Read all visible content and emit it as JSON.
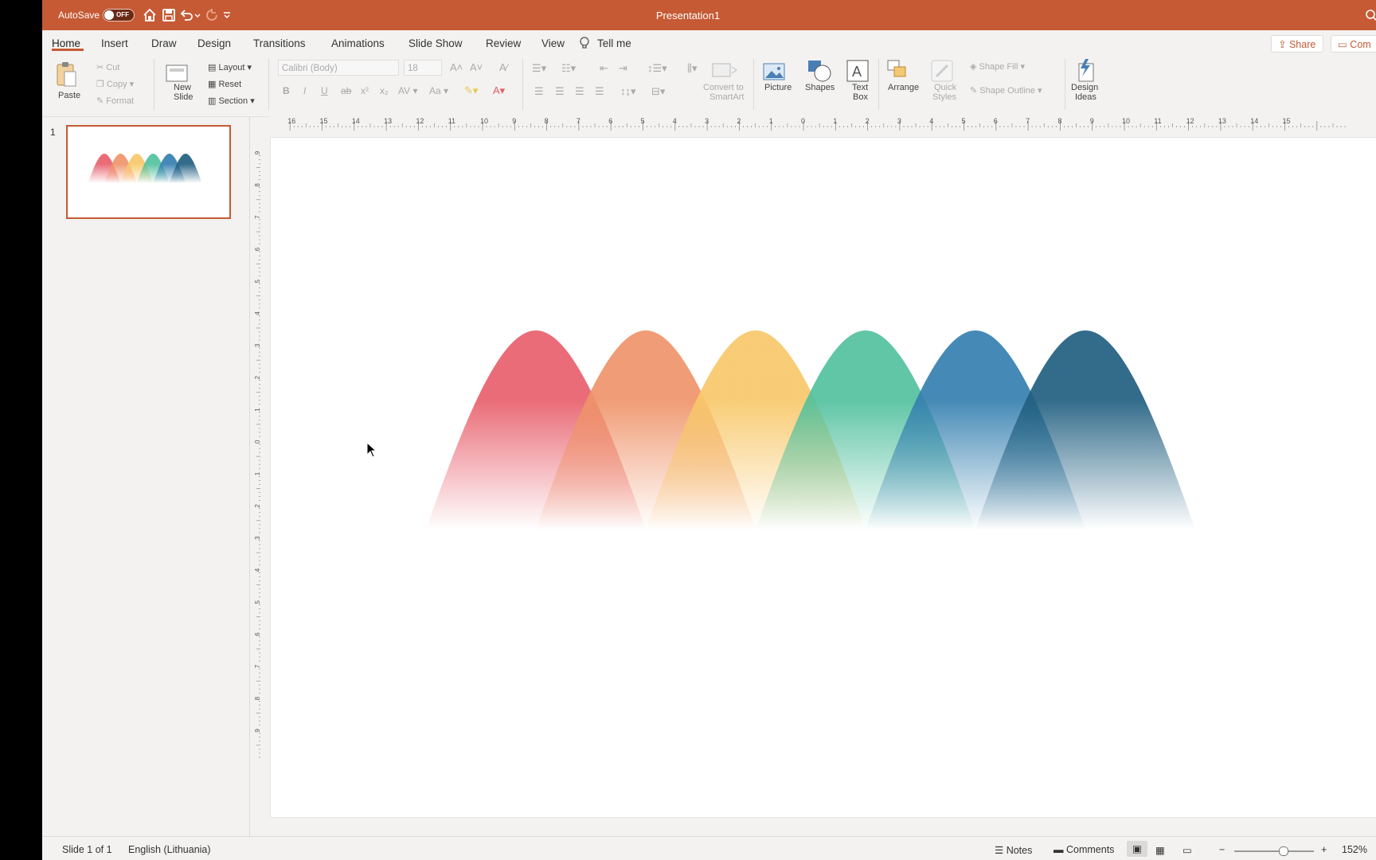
{
  "titlebar": {
    "autosave_label": "AutoSave",
    "autosave_state": "OFF",
    "doc_title": "Presentation1"
  },
  "tabs": [
    {
      "label": "Home"
    },
    {
      "label": "Insert"
    },
    {
      "label": "Draw"
    },
    {
      "label": "Design"
    },
    {
      "label": "Transitions"
    },
    {
      "label": "Animations"
    },
    {
      "label": "Slide Show"
    },
    {
      "label": "Review"
    },
    {
      "label": "View"
    }
  ],
  "tell_me": "Tell me",
  "share_label": "Share",
  "comments_btn_label": "Com",
  "ribbon": {
    "paste": "Paste",
    "cut": "Cut",
    "copy": "Copy",
    "format": "Format",
    "new_slide_1": "New",
    "new_slide_2": "Slide",
    "layout": "Layout",
    "reset": "Reset",
    "section": "Section",
    "font_name": "Calibri (Body)",
    "font_size": "18",
    "convert_1": "Convert to",
    "convert_2": "SmartArt",
    "picture": "Picture",
    "shapes": "Shapes",
    "textbox_1": "Text",
    "textbox_2": "Box",
    "arrange": "Arrange",
    "quick_1": "Quick",
    "quick_2": "Styles",
    "shape_fill": "Shape Fill",
    "shape_outline": "Shape Outline",
    "design_1": "Design",
    "design_2": "Ideas"
  },
  "slides_panel": {
    "number": "1"
  },
  "ruler_h": [
    "16",
    "15",
    "14",
    "13",
    "12",
    "11",
    "10",
    "9",
    "8",
    "7",
    "6",
    "5",
    "4",
    "3",
    "2",
    "1",
    "0",
    "1",
    "2",
    "3",
    "4",
    "5",
    "6",
    "7",
    "8",
    "9",
    "10",
    "11",
    "12",
    "13",
    "14",
    "15"
  ],
  "ruler_v": [
    "9",
    "8",
    "7",
    "6",
    "5",
    "4",
    "3",
    "2",
    "1",
    "0",
    "1",
    "2",
    "3",
    "4",
    "5",
    "6",
    "7",
    "8",
    "9"
  ],
  "arches": [
    {
      "color": "#e8606c"
    },
    {
      "color": "#ef946a"
    },
    {
      "color": "#f8c86a"
    },
    {
      "color": "#52c19e"
    },
    {
      "color": "#3580b0"
    },
    {
      "color": "#215f80"
    }
  ],
  "status": {
    "slide_of": "Slide 1 of 1",
    "language": "English (Lithuania)",
    "notes": "Notes",
    "comments": "Comments",
    "zoom": "152%"
  }
}
